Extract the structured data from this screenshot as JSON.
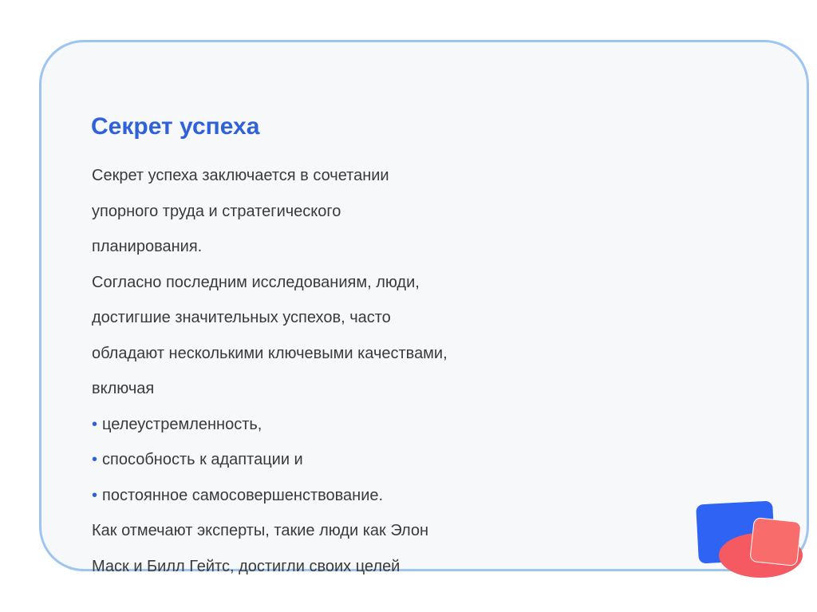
{
  "slide": {
    "title": "Секрет успеха",
    "lines": [
      "Секрет успеха заключается в сочетании",
      "упорного труда и стратегического",
      "планирования.",
      "Согласно последним исследованиям, люди,",
      "достигшие значительных успехов, часто",
      "обладают несколькими ключевыми качествами,",
      "включая"
    ],
    "bullet_symbol": "•",
    "bullets": [
      "целеустремленность,",
      "способность к адаптации и",
      "постоянное самосовершенствование."
    ],
    "closing_lines": [
      "Как отмечают эксперты, такие люди как Элон",
      "Маск и Билл Гейтс, достигли своих целей"
    ]
  },
  "colors": {
    "title": "#2f62d9",
    "text": "#3a3a3a",
    "card_border": "#9ec4f2",
    "card_background": "#f7f8fa",
    "deco_blue": "#2e63f4",
    "deco_red": "#f86c6c",
    "deco_coral": "#f55a62"
  }
}
